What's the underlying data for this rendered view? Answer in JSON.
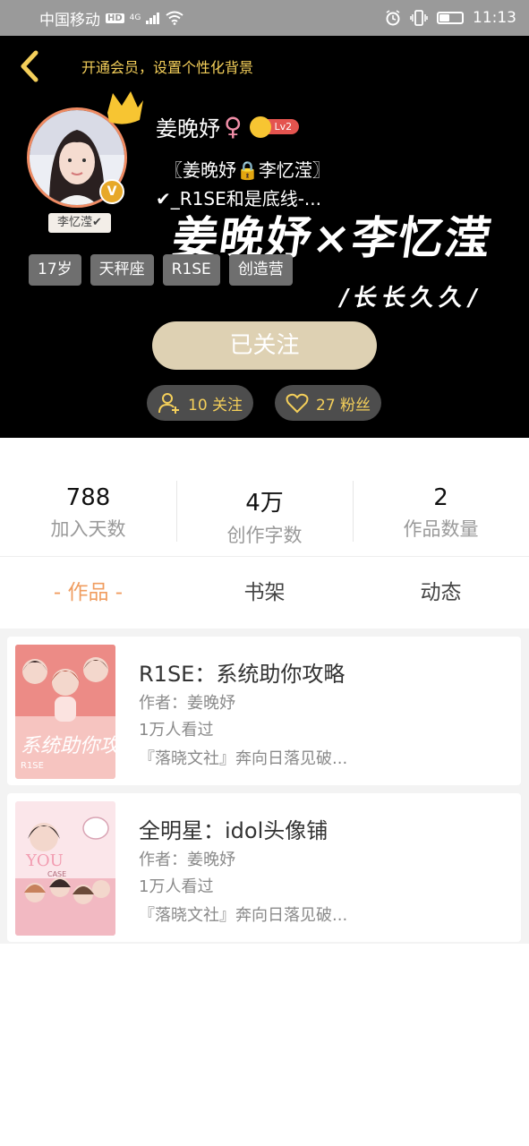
{
  "status_bar": {
    "carrier": "中国移动",
    "hd": "HD",
    "network": "4G",
    "time": "11:13",
    "battery_level": 0.5
  },
  "header": {
    "banner": "开通会员，设置个性化背景"
  },
  "profile": {
    "username": "姜晚妤",
    "gender_symbol": "♀",
    "level": "Lv2",
    "verified_badge": "V",
    "avatar_nametag": "李忆滢✔",
    "bio_line1": "〖姜晚妤🔒李忆滢〗",
    "bio_line2": "✔_R1SE和是底线-...",
    "bg_art_title": "姜晚妤×李忆滢",
    "bg_art_subtitle": "/长长久久/",
    "tags": [
      "17岁",
      "天秤座",
      "R1SE",
      "创造营"
    ],
    "follow_button": "已关注",
    "following": "10 关注",
    "followers": "27 粉丝"
  },
  "stats": [
    {
      "value": "788",
      "label": "加入天数"
    },
    {
      "value": "4万",
      "label": "创作字数"
    },
    {
      "value": "2",
      "label": "作品数量"
    }
  ],
  "tabs": [
    "- 作品 -",
    "书架",
    "动态"
  ],
  "works": [
    {
      "title": "R1SE：系统助你攻略",
      "author": "作者：姜晚妤",
      "views": "1万人看过",
      "intro": "『落晓文社』奔向日落见破...",
      "cover_text": "系统助你攻略",
      "cover_small": "R1SE"
    },
    {
      "title": "全明星：idol头像铺",
      "author": "作者：姜晚妤",
      "views": "1万人看过",
      "intro": "『落晓文社』奔向日落见破...",
      "cover_text": "YOU",
      "cover_small": "CASE"
    }
  ],
  "colors": {
    "accent": "#f09d60",
    "gold": "#f4cf5a",
    "follow_button": "#ded1b3"
  }
}
